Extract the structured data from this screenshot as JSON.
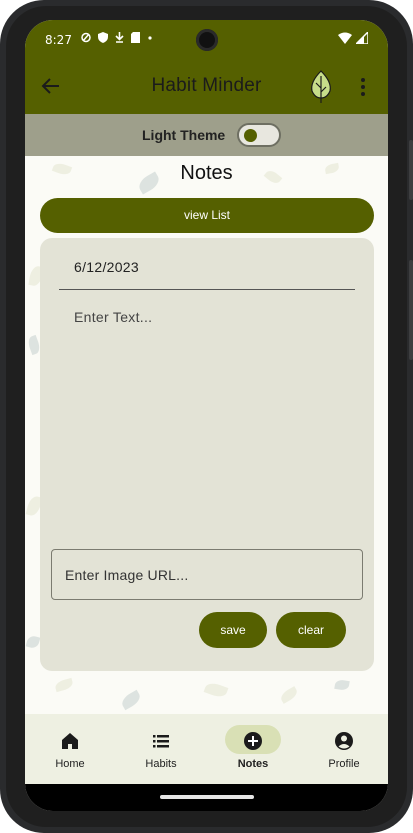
{
  "status_bar": {
    "time": "8:27"
  },
  "app_bar": {
    "title": "Habit Minder"
  },
  "theme_toggle": {
    "label": "Light Theme"
  },
  "page": {
    "heading": "Notes",
    "view_list_label": "view List"
  },
  "note_card": {
    "date": "6/12/2023",
    "text_placeholder": "Enter Text...",
    "image_url_placeholder": "Enter Image URL...",
    "save_label": "save",
    "clear_label": "clear"
  },
  "bottom_nav": {
    "items": [
      {
        "label": "Home",
        "icon": "home-icon"
      },
      {
        "label": "Habits",
        "icon": "list-icon"
      },
      {
        "label": "Notes",
        "icon": "add-circle-icon"
      },
      {
        "label": "Profile",
        "icon": "account-circle-icon"
      }
    ]
  },
  "colors": {
    "primary": "#556000",
    "theme_bar": "#9e9f8b",
    "card": "#e3e3d6",
    "nav_background": "#eef0e2",
    "nav_active_pill": "#d9e0b5"
  }
}
